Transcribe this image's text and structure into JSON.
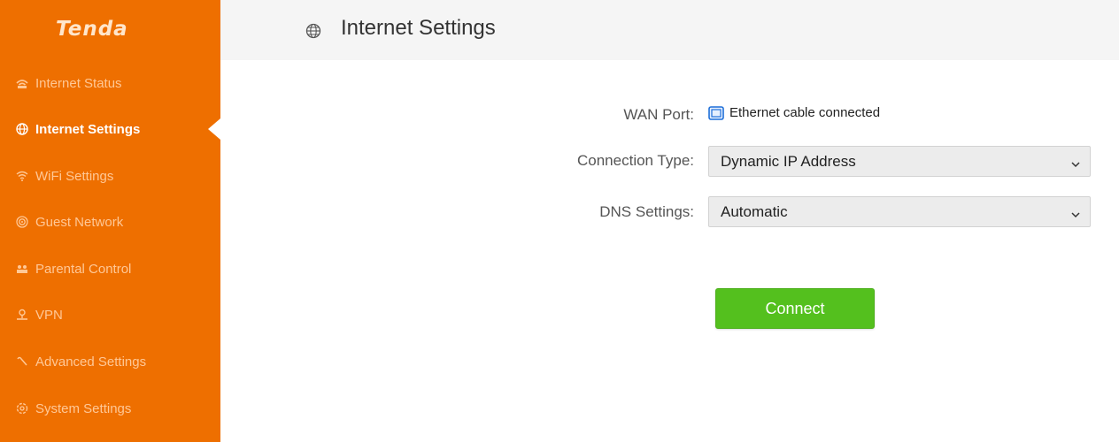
{
  "brand": {
    "logo_text": "Tenda",
    "accent": "#ee6f00"
  },
  "sidebar": {
    "items": [
      {
        "label": "Internet Status",
        "icon": "internet-status-icon"
      },
      {
        "label": "Internet Settings",
        "icon": "globe-icon",
        "active": true
      },
      {
        "label": "WiFi Settings",
        "icon": "wifi-icon"
      },
      {
        "label": "Guest Network",
        "icon": "guest-network-icon"
      },
      {
        "label": "Parental Control",
        "icon": "parental-control-icon"
      },
      {
        "label": "VPN",
        "icon": "vpn-icon"
      },
      {
        "label": "Advanced Settings",
        "icon": "wrench-icon"
      },
      {
        "label": "System Settings",
        "icon": "gear-icon"
      }
    ]
  },
  "header": {
    "title": "Internet Settings",
    "icon": "globe-icon"
  },
  "form": {
    "wan_port": {
      "label": "WAN Port:",
      "status": "Ethernet cable connected",
      "icon": "ethernet-port-icon"
    },
    "connection_type": {
      "label": "Connection Type:",
      "value": "Dynamic IP Address"
    },
    "dns_settings": {
      "label": "DNS Settings:",
      "value": "Automatic"
    },
    "connect_button": {
      "label": "Connect",
      "color": "#54c01e"
    }
  }
}
